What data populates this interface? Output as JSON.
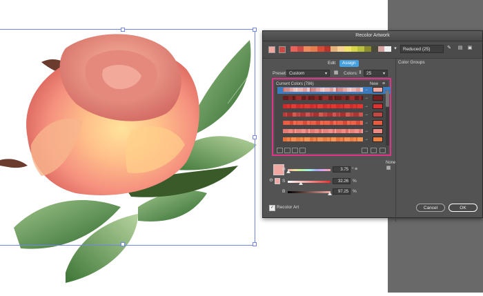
{
  "dialog": {
    "title": "Recolor Artwork",
    "reduced_label": "Reduced (25)",
    "tab_edit": "Edit",
    "tab_assign": "Assign",
    "preset_label": "Preset:",
    "preset_value": "Custom",
    "colors_label": "Colors:",
    "colors_value": "25",
    "color_groups_label": "Color Groups",
    "current_colors_label": "Current Colors (786)",
    "new_label": "New",
    "none_label": "None",
    "h_label": "H",
    "h_value": "3.75",
    "h_unit": "°",
    "s_label": "S",
    "s_value": "32.26",
    "s_unit": "%",
    "b_label": "B",
    "b_value": "97.25",
    "b_unit": "%",
    "recolor_art_label": "Recolor Art",
    "cancel_label": "Cancel",
    "ok_label": "OK"
  },
  "colors": {
    "accent": "#46a1e0",
    "highlight_border": "#e0338a",
    "selected_row": "#3d7bbf",
    "selected_swatch": "#f2a8a2"
  },
  "harmony_swatches": [
    "#e8615a",
    "#c94b44",
    "#f08a5d",
    "#e87c4b",
    "#d84b36",
    "#b8352c",
    "#e2b27a",
    "#f6d08e",
    "#f1e26a",
    "#d6d646",
    "#b9c13c",
    "#8a8d2a",
    "#4a4a3a",
    "#d5a3a0",
    "#f0f0f0"
  ]
}
